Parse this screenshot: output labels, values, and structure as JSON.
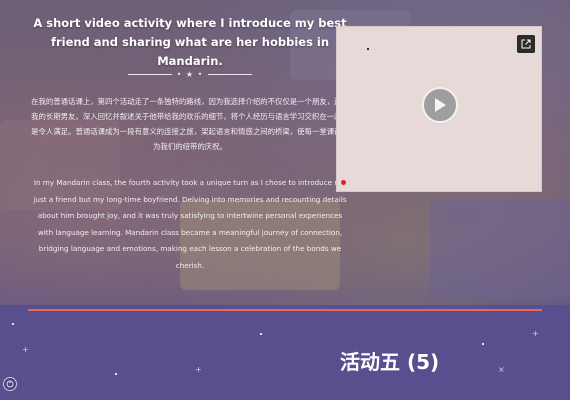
{
  "hero": {
    "heading": "A short video activity where I introduce my best friend and sharing what are her hobbies in Mandarin.",
    "zh_paragraph": "在我的普通话课上，第四个活动走了一条独特的路线，因为我选择介绍的不仅仅是一个朋友，还有我的长期男友。深入回忆并叙述关于他带给我的欢乐的细节，将个人经历与语言学习交织在一起真是令人满足。普通话课成为一段有意义的连接之旅，架起语言和情感之间的桥梁，使每一堂课都成为我们的纽带的庆祝。",
    "en_paragraph": "In my Mandarin class, the fourth activity took a unique turn as I chose to introduce not just a friend but my long-time boyfriend. Delving into memories and recounting details about him brought joy, and it was truly satisfying to intertwine personal experiences with language learning. Mandarin class became a meaningful journey of connection, bridging language and emotions, making each lesson a celebration of the bonds we cherish."
  },
  "video": {
    "state": "paused",
    "play_icon": "play-icon",
    "external_icon": "external-link-icon"
  },
  "section": {
    "title": "活动五 (5)"
  },
  "colors": {
    "accent_rule": "#e2695c",
    "section_bg": "#5a4f8e",
    "video_bg": "#e7d9d8"
  }
}
